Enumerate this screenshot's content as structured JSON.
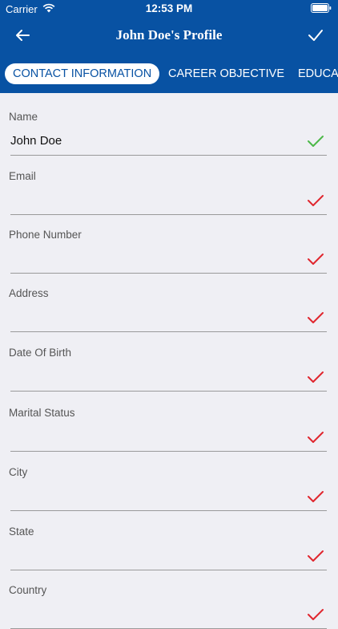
{
  "status_bar": {
    "carrier": "Carrier",
    "time": "12:53 PM"
  },
  "nav": {
    "title": "John Doe's Profile"
  },
  "tabs": [
    {
      "label": "CONTACT INFORMATION",
      "active": true
    },
    {
      "label": "CAREER OBJECTIVE",
      "active": false
    },
    {
      "label": "EDUCATION",
      "active": false
    }
  ],
  "form": {
    "fields": [
      {
        "label": "Name",
        "value": "John Doe",
        "status": "valid"
      },
      {
        "label": "Email",
        "value": "",
        "status": "invalid"
      },
      {
        "label": "Phone Number",
        "value": "",
        "status": "invalid"
      },
      {
        "label": "Address",
        "value": "",
        "status": "invalid"
      },
      {
        "label": "Date Of Birth",
        "value": "",
        "status": "invalid"
      },
      {
        "label": "Marital Status",
        "value": "",
        "status": "invalid"
      },
      {
        "label": "City",
        "value": "",
        "status": "invalid"
      },
      {
        "label": "State",
        "value": "",
        "status": "invalid"
      },
      {
        "label": "Country",
        "value": "",
        "status": "invalid"
      }
    ]
  },
  "colors": {
    "header_bg": "#0852a3",
    "page_bg": "#efeff4",
    "valid_check": "#4cb848",
    "invalid_check": "#e0262e"
  },
  "icons": {
    "back": "arrow-left-icon",
    "done": "checkmark-icon",
    "field_status": "checkmark-icon"
  }
}
